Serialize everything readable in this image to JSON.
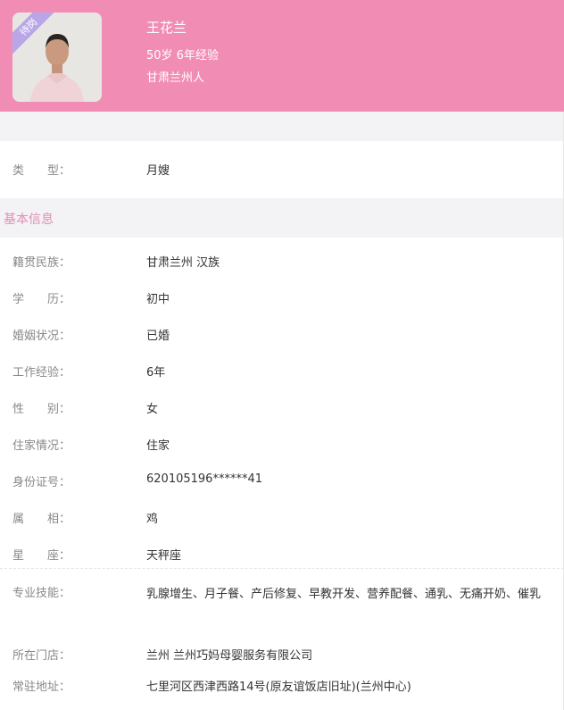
{
  "profile": {
    "badge": "待岗",
    "name": "王花兰",
    "age_experience": "50岁 6年经验",
    "origin": "甘肃兰州人"
  },
  "type_row": {
    "label": "类　　型：",
    "value": "月嫂"
  },
  "section": {
    "title": "基本信息"
  },
  "info": [
    {
      "label": "籍贯民族：",
      "value": "甘肃兰州 汉族"
    },
    {
      "label": "学　　历：",
      "value": "初中"
    },
    {
      "label": "婚姻状况：",
      "value": "已婚"
    },
    {
      "label": "工作经验：",
      "value": "6年"
    },
    {
      "label": "性　　别：",
      "value": "女"
    },
    {
      "label": "住家情况：",
      "value": "住家"
    },
    {
      "label": "身份证号：",
      "value": "620105196******41"
    },
    {
      "label": "属　　相：",
      "value": "鸡"
    },
    {
      "label": "星　　座：",
      "value": "天秤座"
    }
  ],
  "skills": {
    "label": "专业技能：",
    "value": "乳腺增生、月子餐、产后修复、早教开发、营养配餐、通乳、无痛开奶、催乳"
  },
  "store": {
    "label": "所在门店：",
    "value": "兰州 兰州巧妈母婴服务有限公司"
  },
  "address": {
    "label": "常驻地址：",
    "value": "七里河区西津西路14号(原友谊饭店旧址)(兰州中心)"
  },
  "colors": {
    "header": "#f18db4",
    "section_title": "#e58bb4",
    "badge": "#b9a6e8"
  }
}
